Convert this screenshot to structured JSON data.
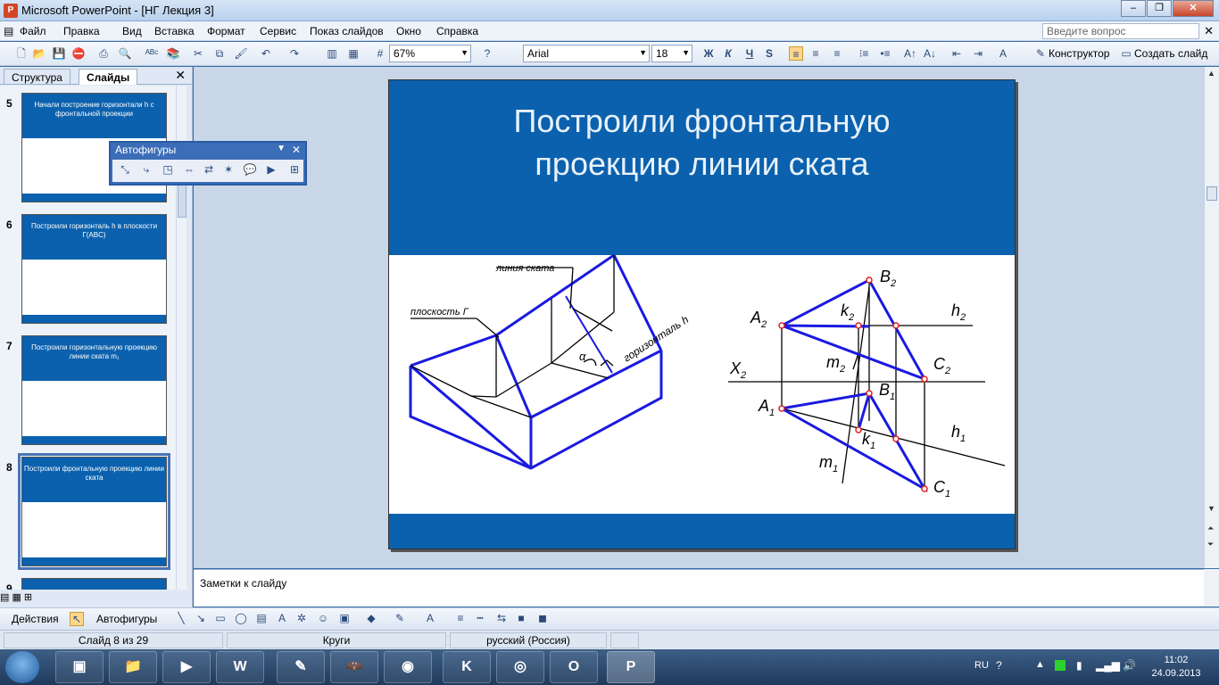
{
  "window": {
    "title": "Microsoft PowerPoint - [НГ Лекция 3]"
  },
  "menu": {
    "items": [
      "Файл",
      "Правка",
      "Вид",
      "Вставка",
      "Формат",
      "Сервис",
      "Показ слайдов",
      "Окно",
      "Справка"
    ],
    "help_placeholder": "Введите вопрос"
  },
  "toolbar": {
    "zoom": "67%",
    "font": "Arial",
    "font_size": "18",
    "bold": "Ж",
    "italic": "К",
    "underline": "Ч",
    "shadow": "S",
    "designer_label": "Конструктор",
    "new_slide_label": "Создать слайд"
  },
  "left_pane": {
    "tabs": [
      "Структура",
      "Слайды"
    ],
    "slides": [
      {
        "num": "5",
        "title": "Начали построение горизонтали h с фронтальной проекции"
      },
      {
        "num": "6",
        "title": "Построили горизонталь h в плоскости Г(ABC)"
      },
      {
        "num": "7",
        "title": "Построили горизонтальную проекцию линии ската m₁"
      },
      {
        "num": "8",
        "title": "Построили фронтальную проекцию линии ската"
      },
      {
        "num": "9",
        "title": ""
      }
    ]
  },
  "autoshapes": {
    "title": "Автофигуры"
  },
  "slide": {
    "title_line1": "Построили фронтальную",
    "title_line2": "проекцию линии ската",
    "labels": {
      "slope_line": "линия ската",
      "plane": "плоскость Г",
      "horizontal": "горизонталь h",
      "alpha": "α",
      "B2": "B",
      "B2_sub": "2",
      "A2": "A",
      "A2_sub": "2",
      "k2": "k",
      "k2_sub": "2",
      "h2": "h",
      "h2_sub": "2",
      "m2": "m",
      "m2_sub": "2",
      "C2": "C",
      "C2_sub": "2",
      "X": "X",
      "X_sub": "2",
      "B1": "B",
      "B1_sub": "1",
      "A1": "A",
      "A1_sub": "1",
      "k1": "k",
      "k1_sub": "1",
      "h1": "h",
      "h1_sub": "1",
      "m1": "m",
      "m1_sub": "1",
      "C1": "C",
      "C1_sub": "1"
    }
  },
  "notes": {
    "placeholder": "Заметки к слайду"
  },
  "drawbar": {
    "actions": "Действия",
    "autoshapes": "Автофигуры"
  },
  "status": {
    "slide": "Слайд 8 из 29",
    "design": "Круги",
    "language": "русский (Россия)"
  },
  "taskbar": {
    "lang": "RU",
    "time": "11:02",
    "date": "24.09.2013"
  },
  "colors": {
    "slide_blue": "#0b61ad",
    "line_blue": "#1a1ae0"
  }
}
